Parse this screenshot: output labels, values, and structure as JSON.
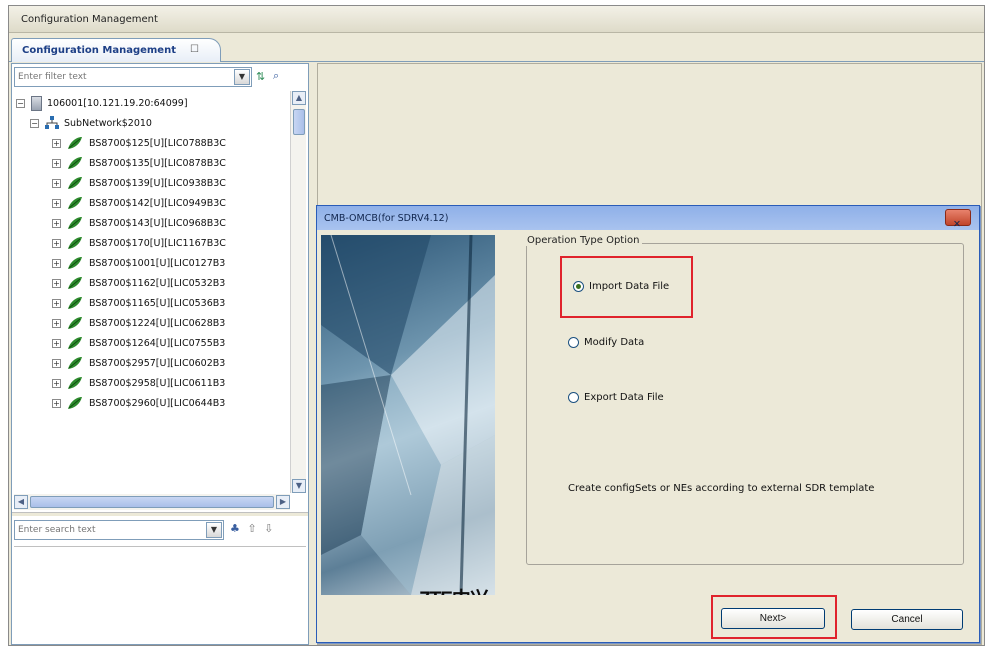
{
  "window": {
    "title": "Configuration Management"
  },
  "tab": {
    "label": "Configuration Management",
    "close_glyph": "☐"
  },
  "tree_panel": {
    "filter_placeholder": "Enter filter text",
    "dropdown_glyph": "▼",
    "tool_icons": [
      "expand-tree-icon",
      "search-icon"
    ],
    "root": "106001[10.121.19.20:64099]",
    "subnetwork": "SubNetwork$2010",
    "nodes": [
      "BS8700$125[U][LIC0788B3C",
      "BS8700$135[U][LIC0878B3C",
      "BS8700$139[U][LIC0938B3C",
      "BS8700$142[U][LIC0949B3C",
      "BS8700$143[U][LIC0968B3C",
      "BS8700$170[U][LIC1167B3C",
      "BS8700$1001[U][LIC0127B3",
      "BS8700$1162[U][LIC0532B3",
      "BS8700$1165[U][LIC0536B3",
      "BS8700$1224[U][LIC0628B3",
      "BS8700$1264[U][LIC0755B3",
      "BS8700$2957[U][LIC0602B3",
      "BS8700$2958[U][LIC0611B3",
      "BS8700$2960[U][LIC0644B3"
    ]
  },
  "search_panel": {
    "placeholder": "Enter search text",
    "dropdown_glyph": "▼",
    "tool_glyphs": [
      "♣",
      "⇧",
      "⇩"
    ]
  },
  "dialog": {
    "title": "CMB-OMCB(for SDRV4.12)",
    "close_glyph": "✕",
    "brand": "ZTE中兴",
    "group_label": "Operation Type Option",
    "options": [
      {
        "label": "Import Data File",
        "selected": true
      },
      {
        "label": "Modify Data",
        "selected": false
      },
      {
        "label": "Export Data File",
        "selected": false
      }
    ],
    "description": "Create configSets or NEs according to external SDR template",
    "next_button": "Next>",
    "cancel_button": "Cancel"
  },
  "colors": {
    "highlight_box": "#e0232c",
    "dialog_title_bar": "#a9c3ef",
    "leaf_icon": "#2e8b2e"
  }
}
